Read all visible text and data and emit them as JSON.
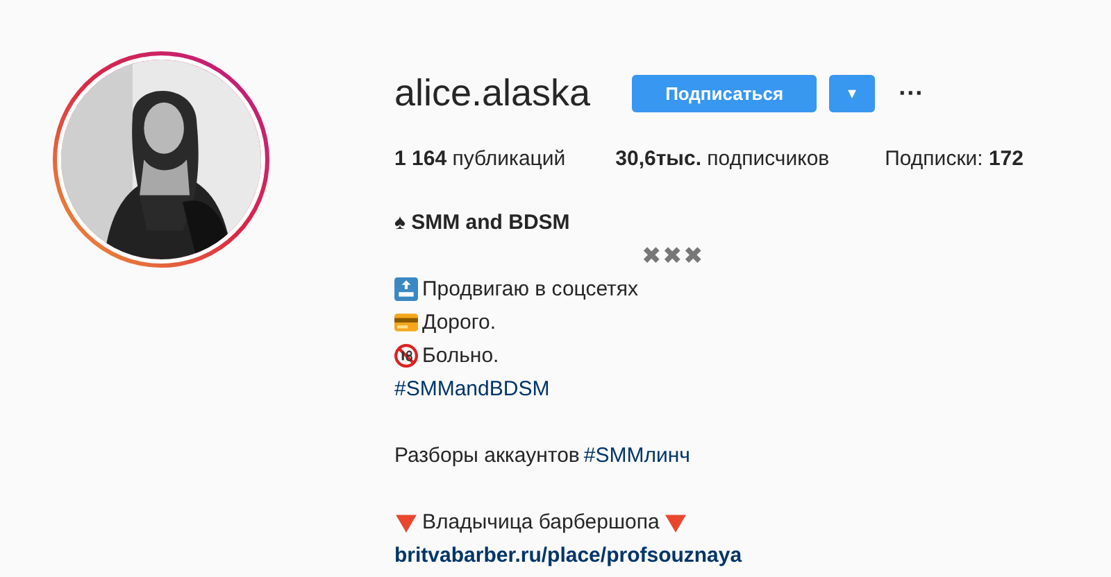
{
  "profile": {
    "username": "alice.alaska",
    "follow_button": "Подписаться",
    "dropdown_button": "▾",
    "more_button": "···"
  },
  "stats": [
    {
      "value": "1 164",
      "label": "публикаций",
      "kind": "suffix"
    },
    {
      "value": "30,6тыс.",
      "label": "подписчиков",
      "kind": "suffix"
    },
    {
      "value": "172",
      "label": "Подписки:",
      "kind": "prefix"
    }
  ],
  "bio": [
    {
      "kind": "title",
      "gap_before": false,
      "parts": [
        {
          "text": "♠ SMM and BDSM",
          "link": false
        }
      ]
    },
    {
      "kind": "symbols",
      "gap_before": false,
      "parts": [
        {
          "text": "✖✖✖",
          "link": false
        }
      ]
    },
    {
      "kind": "top",
      "gap_before": false,
      "parts": [
        {
          "text": "Продвигаю в соцсетях",
          "link": false
        }
      ]
    },
    {
      "kind": "card",
      "gap_before": false,
      "parts": [
        {
          "text": "Дорого.",
          "link": false
        }
      ]
    },
    {
      "kind": "age",
      "gap_before": false,
      "parts": [
        {
          "text": "Больно.",
          "link": false
        }
      ]
    },
    {
      "kind": "text",
      "gap_before": false,
      "parts": [
        {
          "text": "#SMMandBDSM",
          "link": true
        }
      ]
    },
    {
      "kind": "text",
      "gap_before": true,
      "parts": [
        {
          "text": "Разборы аккаунтов ",
          "link": false
        },
        {
          "text": "#SMMлинч",
          "link": true
        }
      ]
    },
    {
      "kind": "triangles",
      "gap_before": true,
      "parts": [
        {
          "text": "Владычица барбершопа",
          "link": false
        }
      ]
    },
    {
      "kind": "website",
      "gap_before": false,
      "parts": [
        {
          "text": "britvabarber.ru/place/profsouznaya",
          "link": true
        }
      ]
    }
  ]
}
